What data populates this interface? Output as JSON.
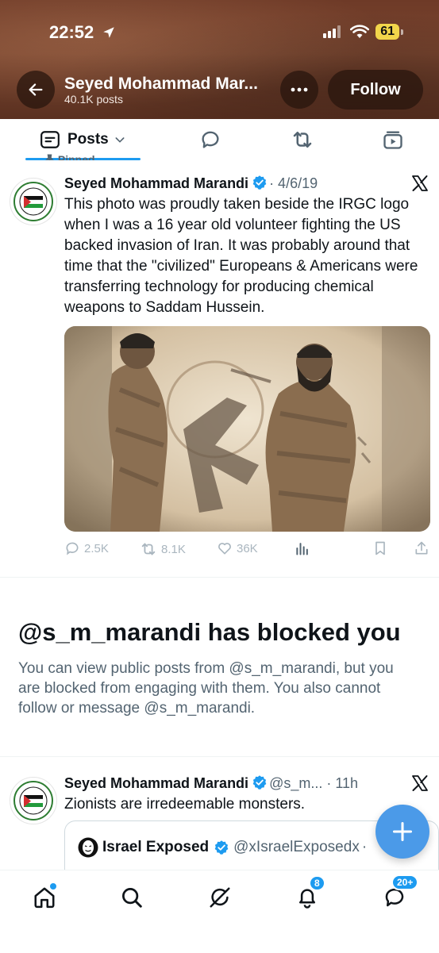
{
  "status_bar": {
    "time": "22:52",
    "battery": "61"
  },
  "header": {
    "profile_name": "Seyed Mohammad Mar...",
    "posts_count": "40.1K posts",
    "follow_label": "Follow"
  },
  "tabs": {
    "posts_label": "Posts"
  },
  "pinned_post": {
    "pinned_label": "Pinned",
    "author_name": "Seyed Mohammad Marandi",
    "date": "· 4/6/19",
    "text": "This photo was proudly taken beside the IRGC logo when I was a 16 year old volunteer fighting the US backed invasion of Iran. It was probably around that time that the \"civilized\" Europeans & Americans were transferring technology for producing chemical weapons to Saddam Hussein.",
    "replies": "2.5K",
    "reposts": "8.1K",
    "likes": "36K"
  },
  "blocked_notice": {
    "title": "@s_m_marandi has blocked you",
    "description": "You can view public posts from @s_m_marandi, but you are blocked from engaging with them. You also cannot follow or message @s_m_marandi."
  },
  "second_post": {
    "author_name": "Seyed Mohammad Marandi",
    "handle": "@s_m...",
    "time": "· 11h",
    "text": "Zionists are irredeemable monsters.",
    "quote_author": "Israel Exposed",
    "quote_handle": "@xIsraelExposedx",
    "quote_time": "· "
  },
  "bottom_nav": {
    "notifications_badge": "8",
    "messages_badge": "20+"
  },
  "colors": {
    "accent": "#1d9bf0",
    "header_bg": "#6e3a27",
    "fab": "#4b9ae8"
  }
}
